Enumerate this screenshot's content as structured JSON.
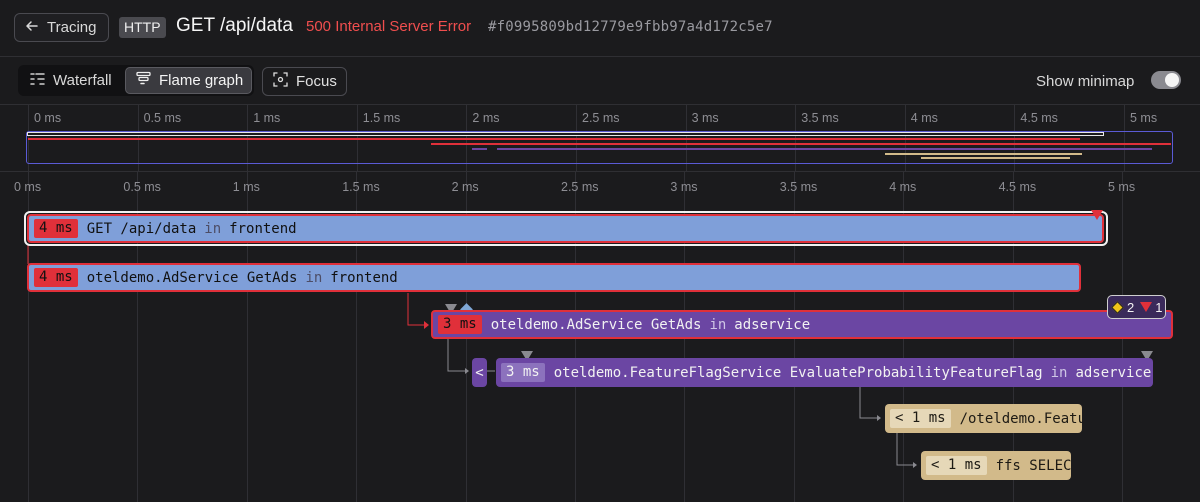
{
  "header": {
    "back_label": "Tracing",
    "method": "HTTP",
    "title": "GET /api/data",
    "status": "500 Internal Server Error",
    "trace_id": "#f0995809bd12779e9fbb97a4d172c5e7"
  },
  "toolbar": {
    "waterfall_label": "Waterfall",
    "flame_label": "Flame graph",
    "focus_label": "Focus",
    "minimap_label": "Show minimap",
    "minimap_enabled": true
  },
  "axis": {
    "ticks": [
      "0 ms",
      "0.5 ms",
      "1 ms",
      "1.5 ms",
      "2 ms",
      "2.5 ms",
      "3 ms",
      "3.5 ms",
      "4 ms",
      "4.5 ms",
      "5 ms"
    ]
  },
  "spans": [
    {
      "duration": "4 ms",
      "name": "GET /api/data",
      "in": "in",
      "service": "frontend",
      "color": "#7f9fd9"
    },
    {
      "duration": "4 ms",
      "name": "oteldemo.AdService GetAds",
      "in": "in",
      "service": "frontend",
      "color": "#7f9fd9"
    },
    {
      "duration": "3 ms",
      "name": "oteldemo.AdService GetAds",
      "in": "in",
      "service": "adservice",
      "color": "#6b46a3"
    },
    {
      "collapsed_label": "<"
    },
    {
      "duration": "3 ms",
      "name": "oteldemo.FeatureFlagService EvaluateProbabilityFeatureFlag",
      "in": "in",
      "service": "adservice",
      "color": "#6b46a3"
    },
    {
      "duration": "< 1 ms",
      "name": "/oteldemo.FeatureFlagService/EvaluateProbabilityFeatureFlag",
      "color": "#d2ba8a"
    },
    {
      "duration": "< 1 ms",
      "name": "ffs SELECT",
      "color": "#d2ba8a"
    }
  ],
  "badge": {
    "warnings": "2",
    "errors": "1"
  },
  "colors": {
    "error": "#e0303a",
    "frontend": "#7f9fd9",
    "adservice": "#6b46a3",
    "database": "#d2ba8a",
    "accent": "#6366f1"
  }
}
